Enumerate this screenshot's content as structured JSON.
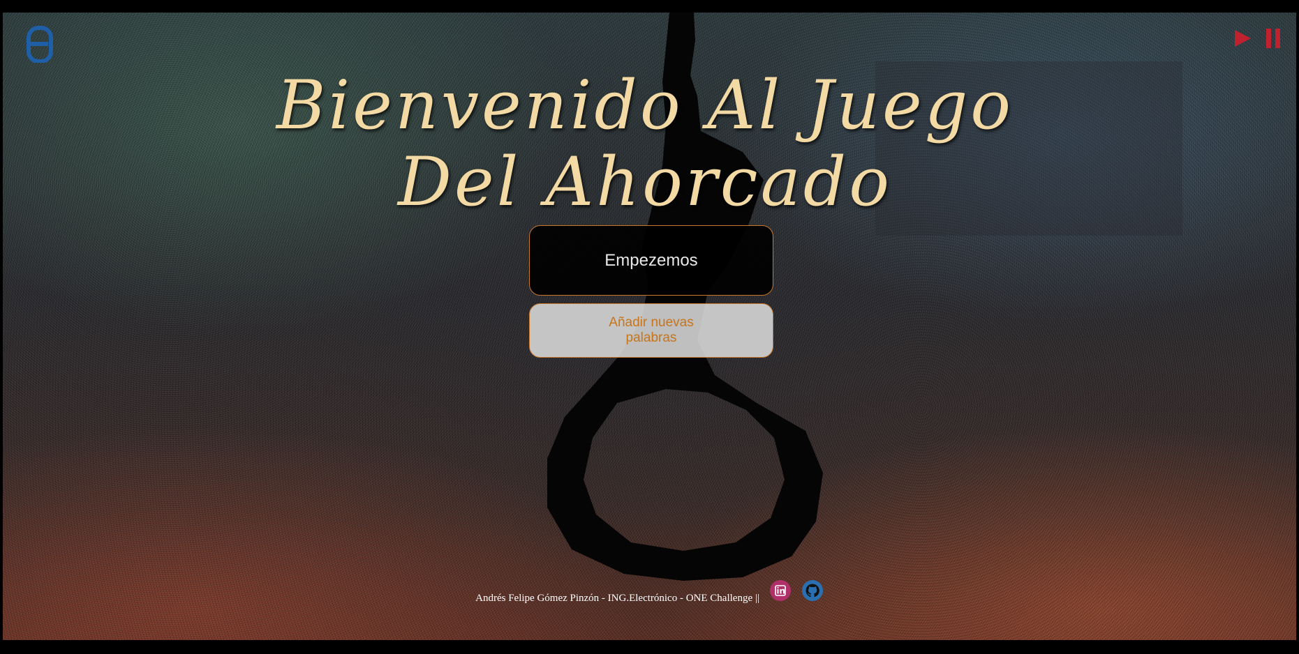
{
  "title": "Bienvenido Al Juego Del Ahorcado",
  "buttons": {
    "start_label": "Empezemos",
    "add_words_label": "Añadir nuevas palabras"
  },
  "footer": {
    "credit": "Andrés Felipe Gómez Pinzón - ING.Electrónico - ONE Challenge ||"
  },
  "icons": {
    "logo": "alura-logo-icon",
    "play": "play-icon",
    "pause": "pause-icon",
    "linkedin": "linkedin-icon",
    "github": "github-icon"
  },
  "colors": {
    "title": "#f3d9a4",
    "button_border": "#c9782c",
    "add_words_text": "#c7741a",
    "audio_controls": "#c0212e",
    "logo": "#1e5fa8",
    "linkedin": "#b0306a",
    "github": "#2a6fb0"
  }
}
